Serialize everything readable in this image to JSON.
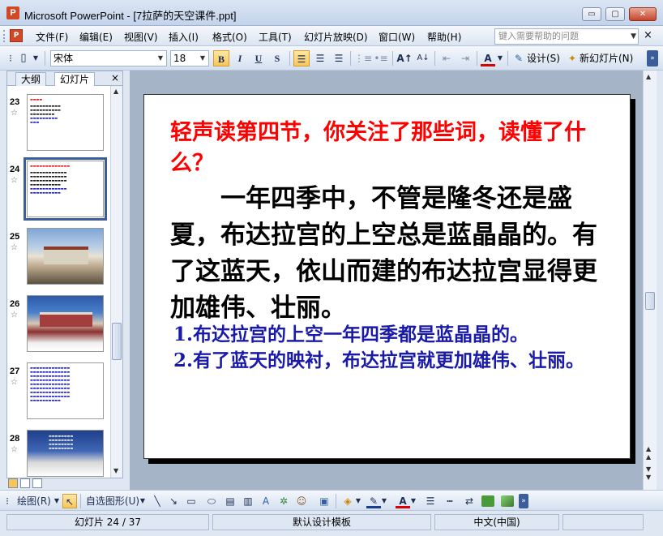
{
  "window": {
    "title": "Microsoft PowerPoint - [7拉萨的天空课件.ppt]",
    "min_glyph": "▭",
    "max_glyph": "▢",
    "close_glyph": "✕"
  },
  "menu": {
    "items": [
      "文件(F)",
      "编辑(E)",
      "视图(V)",
      "插入(I)",
      "格式(O)",
      "工具(T)",
      "幻灯片放映(D)",
      "窗口(W)",
      "帮助(H)"
    ],
    "help_placeholder": "键入需要帮助的问题",
    "close_glyph": "×"
  },
  "toolbar": {
    "font_name": "宋体",
    "font_size": "18",
    "bold": "B",
    "italic": "I",
    "underline": "U",
    "shadow": "S",
    "design_label": "设计(S)",
    "new_slide_label": "新幻灯片(N)"
  },
  "outline_panel": {
    "tab_outline": "大纲",
    "tab_slides": "幻灯片",
    "close_glyph": "×",
    "thumbnails": [
      {
        "number": "23",
        "star": "☆"
      },
      {
        "number": "24",
        "star": "☆"
      },
      {
        "number": "25",
        "star": "☆"
      },
      {
        "number": "26",
        "star": "☆"
      },
      {
        "number": "27",
        "star": "☆"
      },
      {
        "number": "28",
        "star": "☆"
      }
    ]
  },
  "slide": {
    "heading": "轻声读第四节，你关注了那些词，读懂了什么？",
    "body": "一年四季中，不管是隆冬还是盛夏，布达拉宫的上空总是蓝晶晶的。有了这蓝天，依山而建的布达拉宫显得更加雄伟、壮丽。",
    "point1": "1.布达拉宫的上空一年四季都是蓝晶晶的。",
    "point2": "2.有了蓝天的映衬，布达拉宫就更加雄伟、壮丽。"
  },
  "drawbar": {
    "draw_label": "绘图(R)",
    "autoshape_label": "自选图形(U)"
  },
  "status": {
    "slide_position": "幻灯片 24 / 37",
    "template": "默认设计模板",
    "language": "中文(中国)"
  }
}
